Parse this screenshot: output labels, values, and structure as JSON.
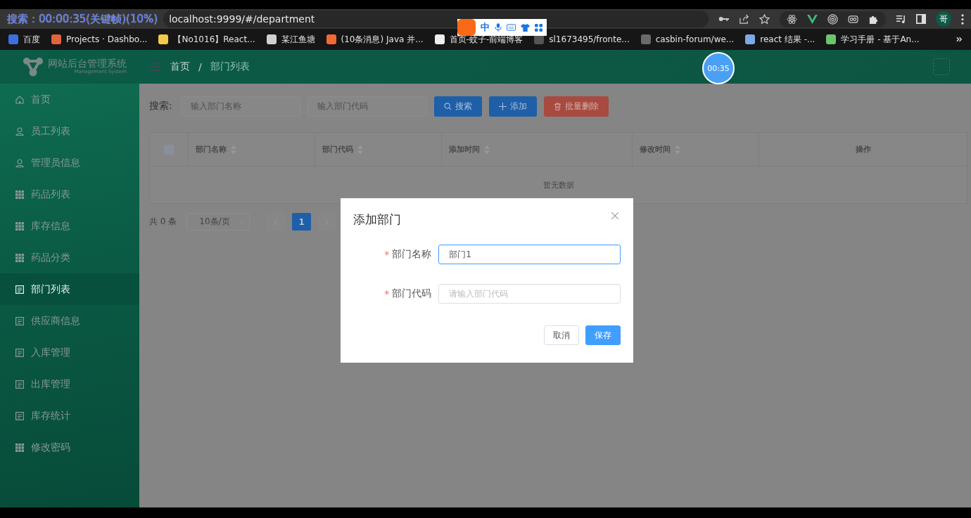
{
  "overlay": {
    "search_info": "搜索：00:00:35(关键帧)(10%)",
    "timer": "00:35"
  },
  "browser": {
    "url": "localhost:9999/#/department",
    "profile": "哥",
    "bookmarks": [
      {
        "label": "百度",
        "color": "#3b6fe0"
      },
      {
        "label": "Projects · Dashbo...",
        "color": "#e2643a"
      },
      {
        "label": "【No1016】React...",
        "color": "#f2c94c"
      },
      {
        "label": "某江鱼塘",
        "color": "#d0d0d0"
      },
      {
        "label": "(10条消息) Java 并...",
        "color": "#f06a35"
      },
      {
        "label": "首页-蚊子-前端博客",
        "color": "#eeeeee"
      },
      {
        "label": "sl1673495/fronte...",
        "color": "#555555"
      },
      {
        "label": "casbin-forum/we...",
        "color": "#6a6a6a"
      },
      {
        "label": "react 结果 -...",
        "color": "#7fa8e8"
      },
      {
        "label": "学习手册 - 基于An...",
        "color": "#6cc46c"
      }
    ]
  },
  "ime_toolbar": {
    "language": "中"
  },
  "app": {
    "title": "网站后台管理系统",
    "subtitle": "Management System",
    "breadcrumb": [
      "首页",
      "部门列表"
    ],
    "breadcrumb_separator": "/"
  },
  "sidebar": {
    "items": [
      {
        "label": "首页",
        "kind": "home",
        "selected": false
      },
      {
        "label": "员工列表",
        "kind": "person",
        "selected": false
      },
      {
        "label": "管理员信息",
        "kind": "person",
        "selected": false
      },
      {
        "label": "药品列表",
        "kind": "table",
        "selected": false
      },
      {
        "label": "库存信息",
        "kind": "table",
        "selected": false
      },
      {
        "label": "药品分类",
        "kind": "table",
        "selected": false
      },
      {
        "label": "部门列表",
        "kind": "page",
        "selected": true
      },
      {
        "label": "供应商信息",
        "kind": "page",
        "selected": false
      },
      {
        "label": "入库管理",
        "kind": "page",
        "selected": false
      },
      {
        "label": "出库管理",
        "kind": "page",
        "selected": false
      },
      {
        "label": "库存统计",
        "kind": "page",
        "selected": false
      },
      {
        "label": "修改密码",
        "kind": "table",
        "selected": false
      }
    ]
  },
  "search": {
    "label": "搜索:",
    "fields": [
      {
        "placeholder": "输入部门名称"
      },
      {
        "placeholder": "输入部门代码"
      }
    ],
    "buttons": [
      {
        "label": "搜索",
        "kind": "search"
      },
      {
        "label": "添加",
        "kind": "add"
      },
      {
        "label": "批量删除",
        "kind": "delete"
      }
    ]
  },
  "table": {
    "select_all": {
      "checked": false
    },
    "columns": [
      {
        "label": "部门名称",
        "sortable": true
      },
      {
        "label": "部门代码",
        "sortable": true
      },
      {
        "label": "添加时间",
        "sortable": true
      },
      {
        "label": "修改时间",
        "sortable": true
      },
      {
        "label": "操作",
        "sortable": false
      }
    ],
    "empty_text": "暂无数据"
  },
  "pagination": {
    "total": "共 0 条",
    "page_size": "10条/页",
    "pages": [
      {
        "label": "1",
        "selected": true
      }
    ]
  },
  "dialog": {
    "title": "添加部门",
    "fields": [
      {
        "label": "部门名称",
        "required_mark": "*",
        "value": "部门1",
        "focused": true
      },
      {
        "label": "部门代码",
        "required_mark": "*",
        "placeholder": "请输入部门代码",
        "focused": false
      }
    ],
    "buttons": [
      {
        "label": "取消",
        "kind": "default"
      },
      {
        "label": "保存",
        "kind": "primary"
      }
    ]
  }
}
